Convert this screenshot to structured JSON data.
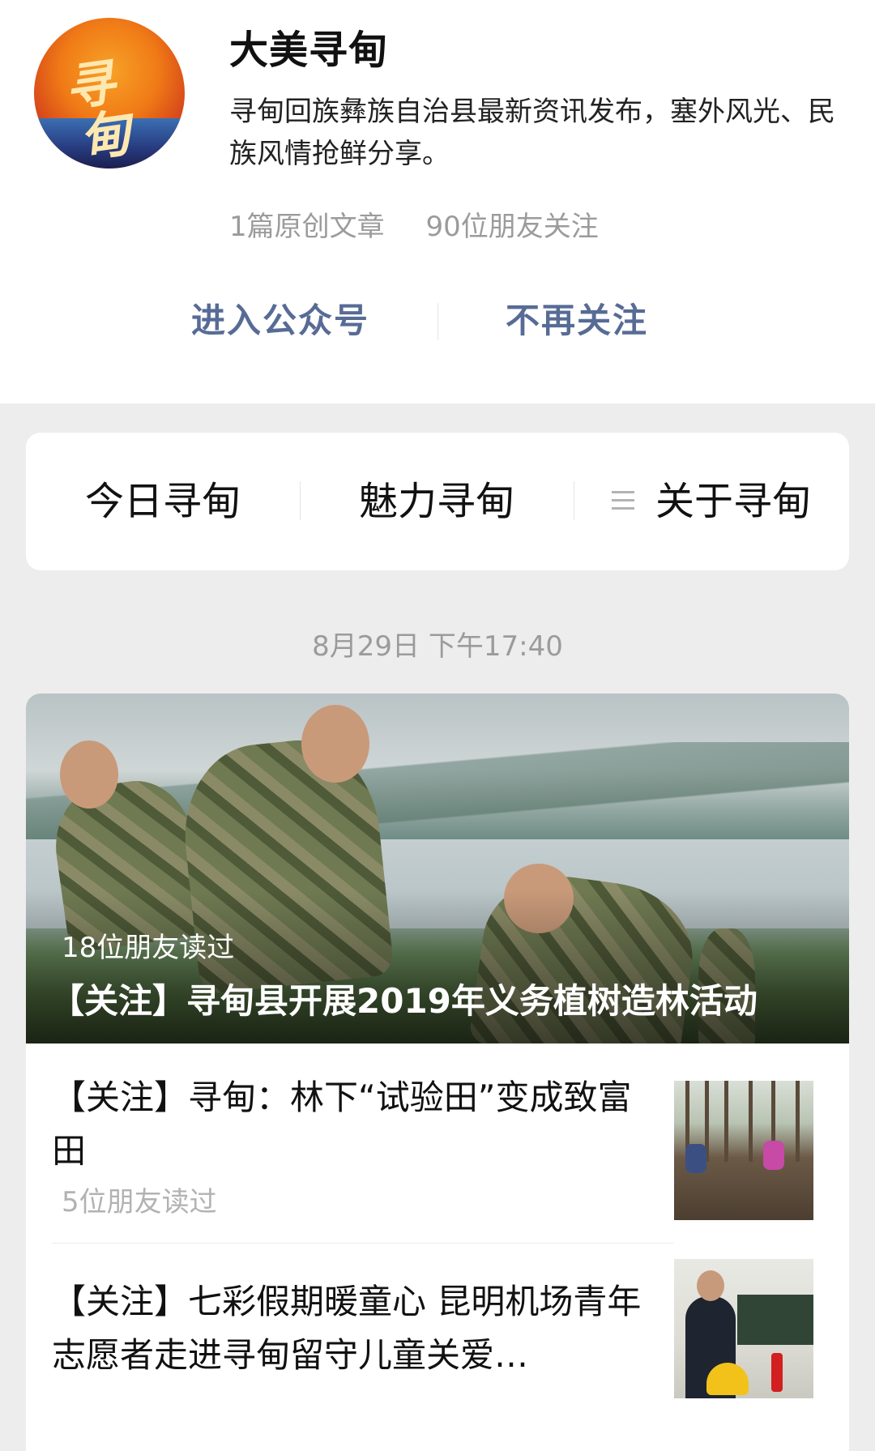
{
  "account": {
    "name": "大美寻甸",
    "description": "寻甸回族彝族自治县最新资讯发布，塞外风光、民族风情抢鲜分享。",
    "original_articles": "1篇原创文章",
    "friends_following": "90位朋友关注",
    "avatar_icon": "xundian-logo",
    "actions": {
      "enter": "进入公众号",
      "unfollow": "不再关注"
    }
  },
  "menu": {
    "items": [
      "今日寻甸",
      "魅力寻甸",
      "关于寻甸"
    ],
    "submenu_icon": "hamburger-icon"
  },
  "feed": {
    "date": "8月29日 下午17:40",
    "hero": {
      "reads": "18位朋友读过",
      "title": "【关注】寻甸县开展2019年义务植树造林活动"
    },
    "items": [
      {
        "title": "【关注】寻甸：林下“试验田”变成致富田",
        "reads": "5位朋友读过",
        "thumb": "forest-field-photo"
      },
      {
        "title": "【关注】七彩假期暖童心 昆明机场青年志愿者走进寻甸留守儿童关爱…",
        "reads": "",
        "thumb": "classroom-firefighter-photo"
      }
    ]
  },
  "colors": {
    "link": "#576b95",
    "background": "#ededed",
    "muted_text": "#9b9b9b"
  }
}
